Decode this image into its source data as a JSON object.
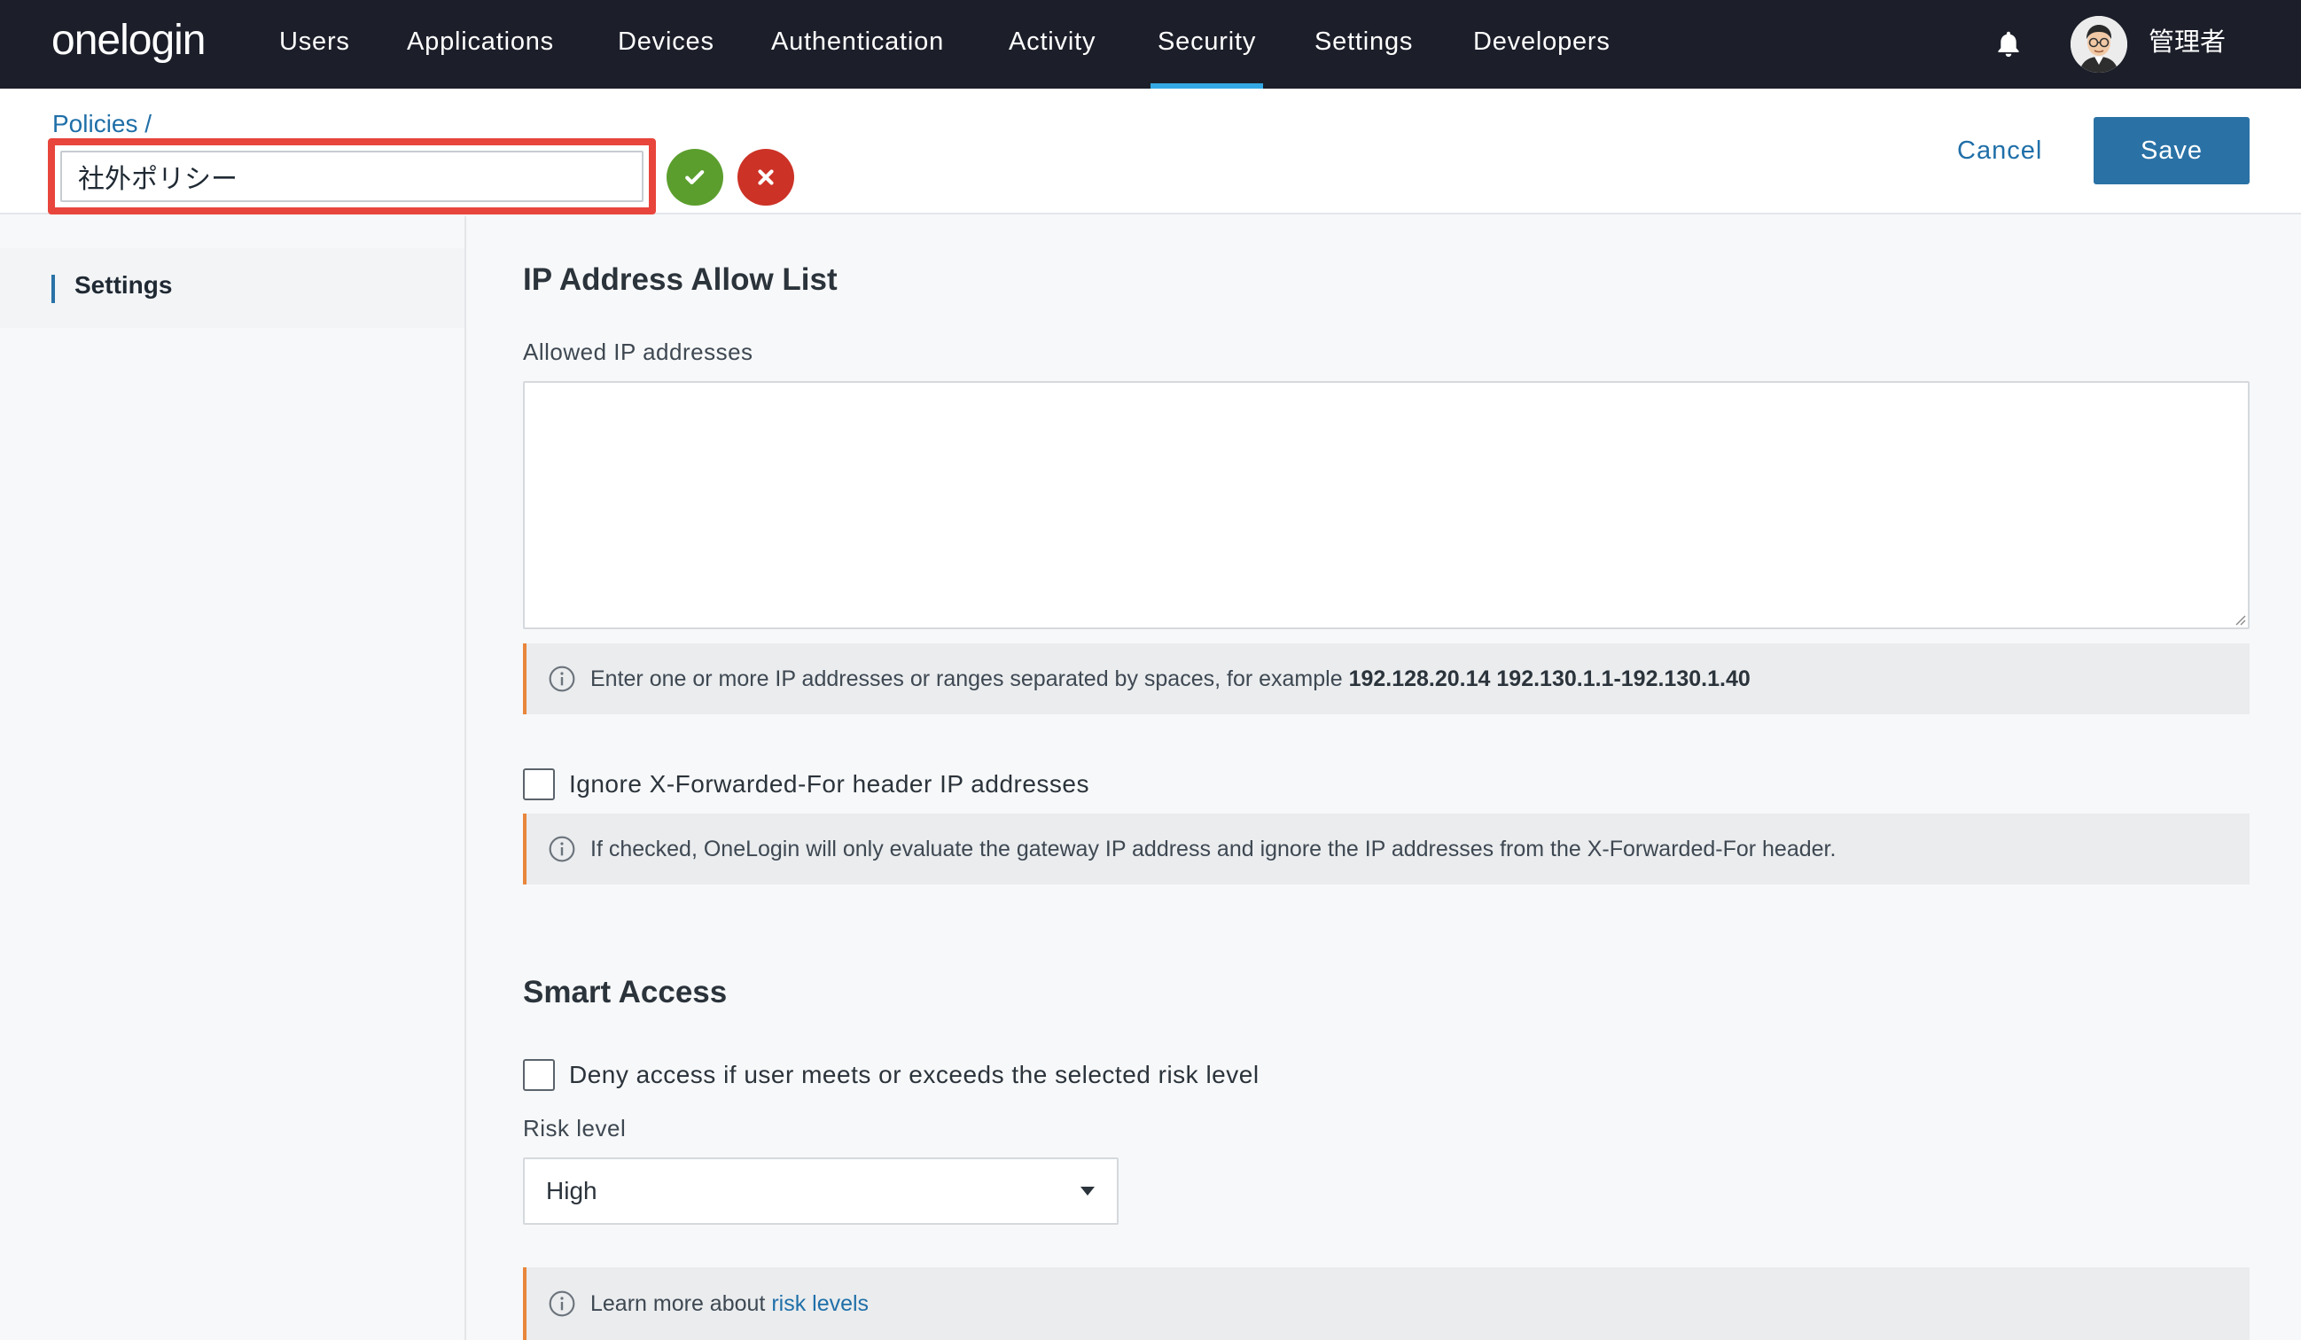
{
  "app": {
    "logo": "onelogin"
  },
  "nav": {
    "items": [
      {
        "label": "Users",
        "active": false
      },
      {
        "label": "Applications",
        "active": false
      },
      {
        "label": "Devices",
        "active": false
      },
      {
        "label": "Authentication",
        "active": false
      },
      {
        "label": "Activity",
        "active": false
      },
      {
        "label": "Security",
        "active": true
      },
      {
        "label": "Settings",
        "active": false
      },
      {
        "label": "Developers",
        "active": false
      }
    ],
    "bell_icon": "bell-icon",
    "user_name": "管理者"
  },
  "header": {
    "breadcrumb": "Policies /",
    "policy_name": "社外ポリシー",
    "cancel_label": "Cancel",
    "save_label": "Save"
  },
  "sidebar": {
    "items": [
      {
        "label": "Settings",
        "active": true
      }
    ]
  },
  "ip_section": {
    "title": "IP Address Allow List",
    "field_label": "Allowed IP addresses",
    "value": "",
    "hint_text": "Enter one or more IP addresses or ranges separated by spaces, for example ",
    "hint_example": "192.128.20.14 192.130.1.1-192.130.1.40",
    "ignore_xff_label": "Ignore X-Forwarded-For header IP addresses",
    "ignore_xff_checked": false,
    "xff_hint": "If checked, OneLogin will only evaluate the gateway IP address and ignore the IP addresses from the X-Forwarded-For header."
  },
  "smart_access": {
    "title": "Smart Access",
    "deny_label": "Deny access if user meets or exceeds the selected risk level",
    "deny_checked": false,
    "risk_label": "Risk level",
    "risk_value": "High",
    "learn_prefix": "Learn more about ",
    "learn_link": "risk levels"
  },
  "colors": {
    "nav_bg": "#1c1f2a",
    "nav_active_underline": "#34a8e4",
    "link": "#1f6fa8",
    "primary_button": "#2a72a6",
    "confirm_green": "#5b9e2d",
    "discard_red": "#cc3226",
    "highlight_outline": "#e8453c",
    "info_accent": "#e8863b"
  }
}
